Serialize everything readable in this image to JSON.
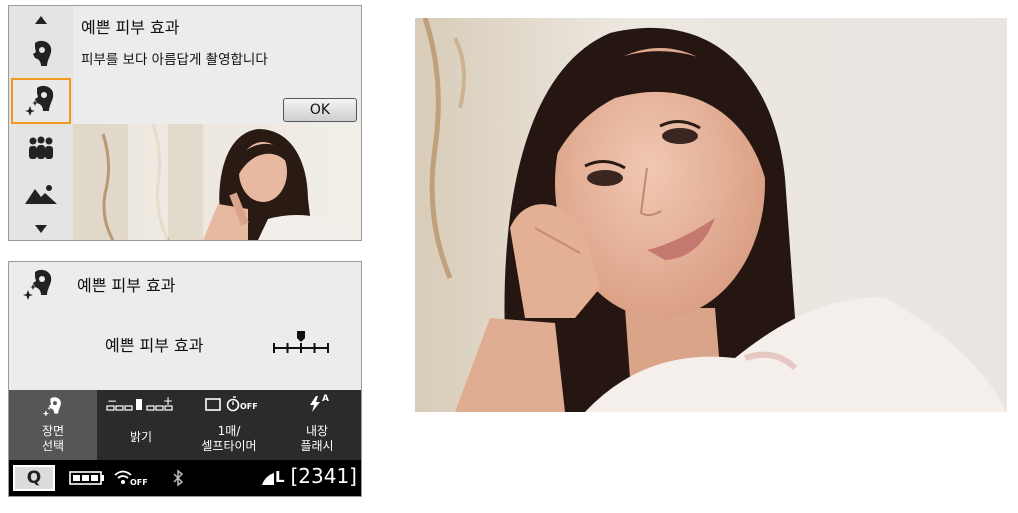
{
  "scene_menu": {
    "title": "예쁜 피부 효과",
    "description": "피부를 보다 아름답게 촬영합니다",
    "ok_label": "OK",
    "sidebar_icons": [
      "arrow-up-icon",
      "portrait-icon",
      "smooth-skin-icon",
      "group-photo-icon",
      "landscape-icon",
      "arrow-down-icon"
    ],
    "selected_index": 2
  },
  "quick_control": {
    "title": "예쁜 피부 효과",
    "setting_label": "예쁜 피부 효과",
    "effect_level": 2,
    "effect_levels": 5,
    "bar": {
      "scene_label": "장면\n선택",
      "brightness_label": "밝기",
      "brightness_minus": "−",
      "brightness_plus": "+",
      "drive_label": "1매/\n셀프타이머",
      "drive_timer": "OFF",
      "flash_label": "내장\n플래시",
      "flash_mode": "A"
    },
    "status": {
      "q_label": "Q",
      "wifi_state": "OFF",
      "quality": "L",
      "shots_remaining": "[2341]"
    }
  },
  "colors": {
    "accent": "#f39a1e",
    "bar_bg": "#2b2b2b",
    "selected_bg": "#565656"
  }
}
